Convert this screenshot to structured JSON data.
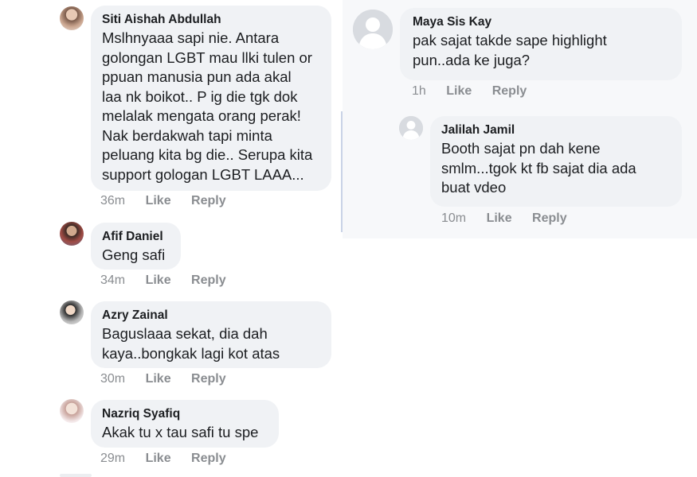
{
  "left_comments": [
    {
      "author": "Siti Aishah Abdullah",
      "text": "Mslhnyaaa sapi nie. Antara\ngolongan LGBT mau llki tulen or\nppuan manusia pun ada akal\nlaa nk boikot.. P ig die tgk dok\nmelalak mengata orang perak!\nNak berdakwah tapi minta\npeluang kita bg die.. Serupa kita\nsupport gologan LGBT LAAA...",
      "time": "36m",
      "like": "Like",
      "reply": "Reply",
      "avatar_icon": "user-photo-icon"
    },
    {
      "author": "Afif Daniel",
      "text": "Geng safi",
      "time": "34m",
      "like": "Like",
      "reply": "Reply",
      "avatar_icon": "user-photo-icon"
    },
    {
      "author": "Azry Zainal",
      "text": "Baguslaaa sekat, dia dah\nkaya..bongkak lagi kot atas",
      "time": "30m",
      "like": "Like",
      "reply": "Reply",
      "avatar_icon": "user-photo-icon"
    },
    {
      "author": "Nazriq Syafiq",
      "text": "Akak tu x tau safi tu spe",
      "time": "29m",
      "like": "Like",
      "reply": "Reply",
      "avatar_icon": "user-photo-icon"
    }
  ],
  "right_comments": [
    {
      "author": "Maya Sis Kay",
      "text": "pak sajat takde sape highlight\npun..ada ke juga?",
      "time": "1h",
      "like": "Like",
      "reply": "Reply",
      "avatar_icon": "default-avatar-icon"
    },
    {
      "author": "Jalilah Jamil",
      "text": "Booth sajat pn dah kene\nsmlm...tgok kt fb sajat dia ada\nbuat vdeo",
      "time": "10m",
      "like": "Like",
      "reply": "Reply",
      "avatar_icon": "default-avatar-icon"
    }
  ],
  "colors": {
    "bubble": "#f0f2f5",
    "text": "#1c1e21",
    "meta": "#8a8d91",
    "right_background": "#f7f8fa",
    "thread_line": "#c9d3e6"
  }
}
